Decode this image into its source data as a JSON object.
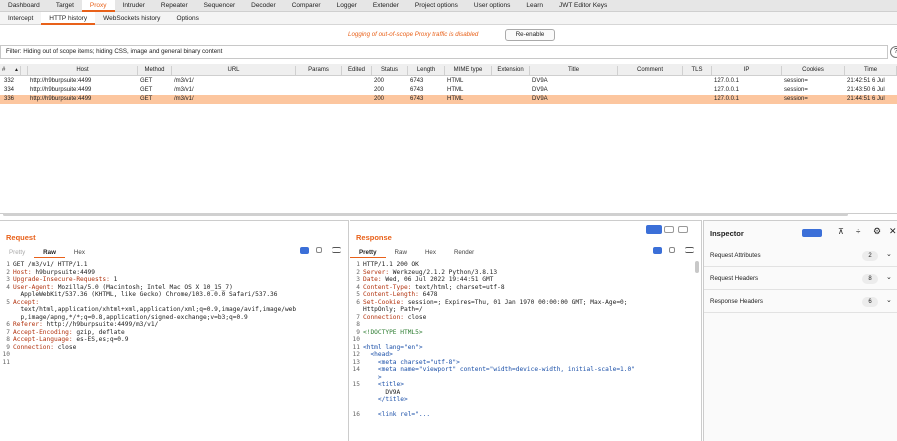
{
  "top_tabs": [
    "Dashboard",
    "Target",
    "Proxy",
    "Intruder",
    "Repeater",
    "Sequencer",
    "Decoder",
    "Comparer",
    "Logger",
    "Extender",
    "Project options",
    "User options",
    "Learn",
    "JWT Editor Keys"
  ],
  "proxy_tabs": [
    "Intercept",
    "HTTP history",
    "WebSockets history",
    "Options"
  ],
  "notice": {
    "message": "Logging of out-of-scope Proxy traffic is disabled",
    "button": "Re-enable"
  },
  "filter": "Filter: Hiding out of scope items;  hiding CSS, image and general binary content",
  "help_icon": "?",
  "table": {
    "headers": [
      "#",
      "Host",
      "Method",
      "URL",
      "Params",
      "Edited",
      "Status",
      "Length",
      "MIME type",
      "Extension",
      "Title",
      "Comment",
      "TLS",
      "IP",
      "Cookies",
      "Time"
    ],
    "sort_indicator": "▲",
    "rows": [
      [
        "332",
        "http://h9burpsuite:4499",
        "GET",
        "/m3/v1/",
        "",
        "",
        "200",
        "6743",
        "HTML",
        "",
        "DV9A",
        "",
        "",
        "127.0.0.1",
        "session=",
        "21:42:51 6 Jul"
      ],
      [
        "334",
        "http://h9burpsuite:4499",
        "GET",
        "/m3/v1/",
        "",
        "",
        "200",
        "6743",
        "HTML",
        "",
        "DV9A",
        "",
        "",
        "127.0.0.1",
        "session=",
        "21:43:50 6 Jul"
      ],
      [
        "336",
        "http://h9burpsuite:4499",
        "GET",
        "/m3/v1/",
        "",
        "",
        "200",
        "6743",
        "HTML",
        "",
        "DV9A",
        "",
        "",
        "127.0.0.1",
        "session=",
        "21:44:51 6 Jul"
      ]
    ],
    "selected_row": 2
  },
  "request": {
    "title": "Request",
    "tabs": [
      "Pretty",
      "Raw",
      "Hex"
    ],
    "active_tab": "Raw",
    "lines": [
      {
        "n": "1",
        "text": "GET /m3/v1/ HTTP/1.1"
      },
      {
        "n": "2",
        "key": "Host:",
        "val": " h9burpsuite:4499"
      },
      {
        "n": "3",
        "key": "Upgrade-Insecure-Requests:",
        "val": " 1"
      },
      {
        "n": "4",
        "key": "User-Agent:",
        "val": " Mozilla/5.0 (Macintosh; Intel Mac OS X 10_15_7)"
      },
      {
        "n": "",
        "text": "  AppleWebKit/537.36 (KHTML, like Gecko) Chrome/103.0.0.0 Safari/537.36"
      },
      {
        "n": "5",
        "key": "Accept:",
        "val": ""
      },
      {
        "n": "",
        "text": "  text/html,application/xhtml+xml,application/xml;q=0.9,image/avif,image/web"
      },
      {
        "n": "",
        "text": "  p,image/apng,*/*;q=0.8,application/signed-exchange;v=b3;q=0.9"
      },
      {
        "n": "6",
        "key": "Referer:",
        "val": " http://h9burpsuite:4499/m3/v1/"
      },
      {
        "n": "7",
        "key": "Accept-Encoding:",
        "val": " gzip, deflate"
      },
      {
        "n": "8",
        "key": "Accept-Language:",
        "val": " es-ES,es;q=0.9"
      },
      {
        "n": "9",
        "key": "Connection:",
        "val": " close"
      },
      {
        "n": "10",
        "text": ""
      },
      {
        "n": "11",
        "text": ""
      }
    ]
  },
  "response": {
    "title": "Response",
    "tabs": [
      "Pretty",
      "Raw",
      "Hex",
      "Render"
    ],
    "active_tab": "Pretty",
    "lines": [
      {
        "n": "1",
        "text": "HTTP/1.1 200 OK"
      },
      {
        "n": "2",
        "key": "Server:",
        "val": " Werkzeug/2.1.2 Python/3.8.13"
      },
      {
        "n": "3",
        "key": "Date:",
        "val": " Wed, 06 Jul 2022 19:44:51 GMT"
      },
      {
        "n": "4",
        "key": "Content-Type:",
        "val": " text/html; charset=utf-8"
      },
      {
        "n": "5",
        "key": "Content-Length:",
        "val": " 6478"
      },
      {
        "n": "6",
        "key": "Set-Cookie:",
        "val": " session=; Expires=Thu, 01 Jan 1970 00:00:00 GMT; Max-Age=0;"
      },
      {
        "n": "",
        "text": "HttpOnly; Path=/"
      },
      {
        "n": "7",
        "key": "Connection:",
        "val": " close"
      },
      {
        "n": "8",
        "text": ""
      },
      {
        "n": "9",
        "kind": "cm",
        "text": "<!DOCTYPE HTML5>"
      },
      {
        "n": "10",
        "text": ""
      },
      {
        "n": "11",
        "kind": "tag",
        "text": "<html lang=\"en\">"
      },
      {
        "n": "12",
        "kind": "tag",
        "text": "  <head>"
      },
      {
        "n": "13",
        "kind": "tag",
        "text": "    <meta charset=\"utf-8\">"
      },
      {
        "n": "14",
        "kind": "tag",
        "text": "    <meta name=\"viewport\" content=\"width=device-width, initial-scale=1.0\""
      },
      {
        "n": "",
        "kind": "tag",
        "text": "    >"
      },
      {
        "n": "15",
        "kind": "tag",
        "text": "    <title>"
      },
      {
        "n": "",
        "text": "      DV9A"
      },
      {
        "n": "",
        "kind": "tag",
        "text": "    </title>"
      },
      {
        "n": "",
        "text": ""
      },
      {
        "n": "16",
        "kind": "tag",
        "text": "    <link rel=\"..."
      }
    ]
  },
  "inspector": {
    "title": "Inspector",
    "items": [
      {
        "label": "Request Attributes",
        "count": "2"
      },
      {
        "label": "Request Headers",
        "count": "8"
      },
      {
        "label": "Response Headers",
        "count": "6"
      }
    ]
  },
  "colors": {
    "accent": "#e8611a",
    "selected_row": "#fcc69f",
    "toggle_blue": "#3b6fd8"
  }
}
